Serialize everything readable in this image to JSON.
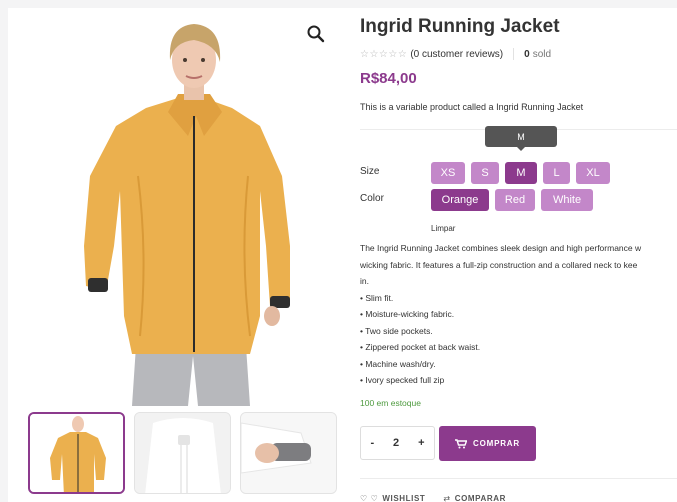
{
  "product": {
    "title": "Ingrid Running Jacket",
    "stars": "☆☆☆☆☆",
    "reviews_text": "(0 customer reviews)",
    "sold_count": "0",
    "sold_label": "sold",
    "price": "R$84,00",
    "short_description": "This is a variable product called a Ingrid Running Jacket"
  },
  "tooltip": "M",
  "attributes": {
    "size_label": "Size",
    "sizes": [
      "XS",
      "S",
      "M",
      "L",
      "XL"
    ],
    "selected_size": "M",
    "color_label": "Color",
    "colors": [
      "Orange",
      "Red",
      "White"
    ],
    "selected_color": "Orange",
    "clear_label": "Limpar"
  },
  "description": {
    "lines": [
      "The Ingrid Running Jacket combines sleek design and high performance w",
      "wicking fabric. It features a full-zip construction and a collared neck to kee",
      "in."
    ],
    "bullets": [
      "• Slim fit.",
      "• Moisture-wicking fabric.",
      "• Two side pockets.",
      "• Zippered pocket at back waist.",
      "• Machine wash/dry.",
      "• Ivory specked full zip"
    ]
  },
  "stock": "100 em estoque",
  "quantity": {
    "minus": "-",
    "value": "2",
    "plus": "+"
  },
  "add_button_label": "COMPRAR",
  "actions": {
    "wishlist_label": "WISHLIST",
    "compare_label": "COMPARAR"
  },
  "colors": {
    "accent": "#8c3a8d",
    "swatch": "#c387c9",
    "stock": "#4e9a3f",
    "jacket": "#ebb04e"
  },
  "icons": {
    "zoom": "search-icon",
    "cart": "cart-icon",
    "wishlist": "heart-icon",
    "compare": "compare-icon"
  }
}
